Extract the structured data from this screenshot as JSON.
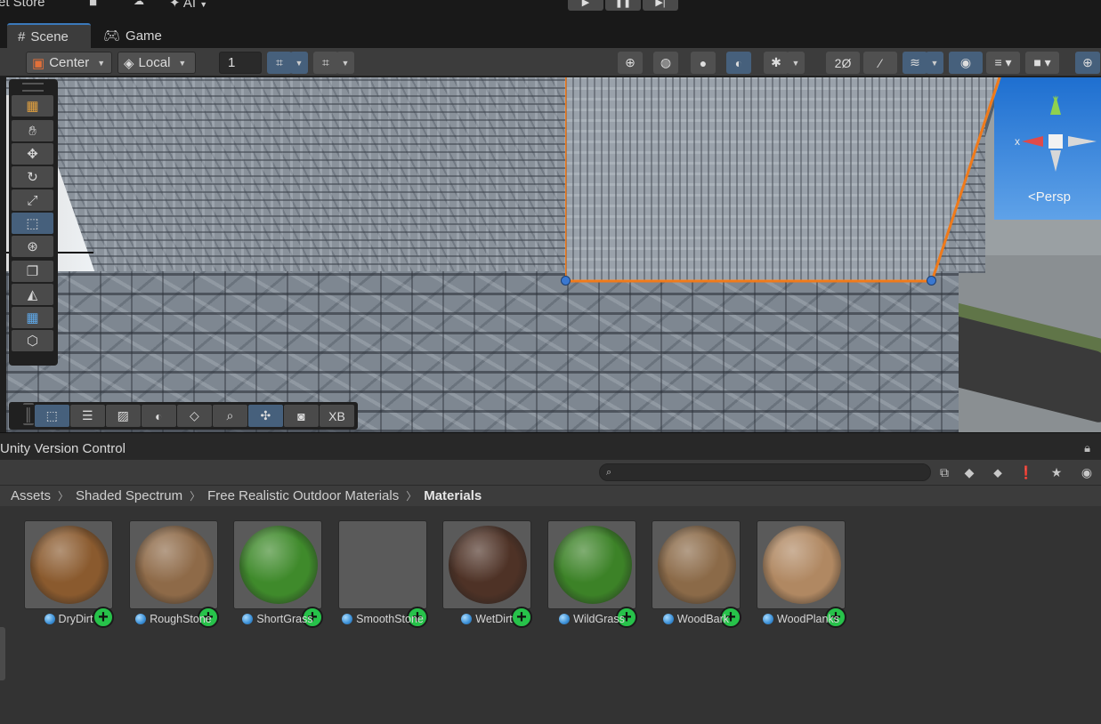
{
  "topbar": {
    "asset_store": "et Store",
    "ai_label": "AI"
  },
  "tabs": [
    {
      "label": "Scene",
      "icon": "grid-icon"
    },
    {
      "label": "Game",
      "icon": "gamepad-icon"
    }
  ],
  "scene_toolbar": {
    "pivot_mode": "Center",
    "pivot_rotation": "Local",
    "grid_snap_value": "1",
    "camera_toggle": "XB"
  },
  "scene_view": {
    "camera_mode": "Persp",
    "gizmo_axes": {
      "x": "x",
      "y": "y"
    }
  },
  "panel": {
    "title": "Unity Version Control"
  },
  "project": {
    "search_placeholder": "",
    "breadcrumb": [
      "Assets",
      "Shaded Spectrum",
      "Free Realistic Outdoor Materials",
      "Materials"
    ],
    "assets": [
      {
        "name": "DryDirt",
        "swatch": "#8a5a2e"
      },
      {
        "name": "RoughStone",
        "swatch": "#8e6a48"
      },
      {
        "name": "ShortGrass",
        "swatch": "#3f8a2b"
      },
      {
        "name": "SmoothStone",
        "swatch": ""
      },
      {
        "name": "WetDirt",
        "swatch": "#4e3226"
      },
      {
        "name": "WildGrass",
        "swatch": "#3c8227"
      },
      {
        "name": "WoodBark",
        "swatch": "#8b6a48"
      },
      {
        "name": "WoodPlanks",
        "swatch": "#b08862"
      }
    ]
  },
  "colors": {
    "accent": "#3a79bb",
    "selection_outline": "#f07a1a",
    "add_badge": "#27c24a"
  }
}
